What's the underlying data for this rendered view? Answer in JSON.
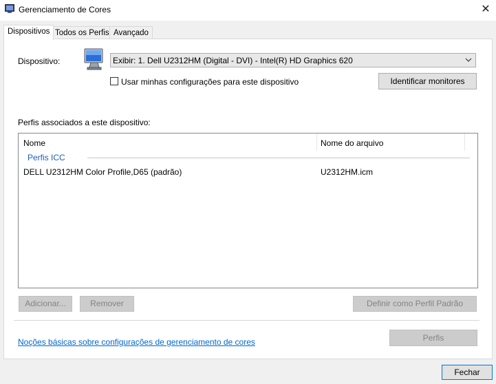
{
  "window": {
    "title": "Gerenciamento de Cores",
    "close_glyph": "✕"
  },
  "tabs": [
    {
      "label": "Dispositivos",
      "active": true
    },
    {
      "label": "Todos os Perfis",
      "active": false
    },
    {
      "label": "Avançado",
      "active": false
    }
  ],
  "device": {
    "label": "Dispositivo:",
    "selected": "Exibir: 1. Dell U2312HM (Digital - DVI) - Intel(R) HD Graphics 620",
    "use_my_settings_label": "Usar minhas configurações para este dispositivo",
    "use_my_settings_checked": false,
    "identify_button": "Identificar monitores"
  },
  "profiles": {
    "section_label": "Perfis associados a este dispositivo:",
    "columns": [
      "Nome",
      "Nome do arquivo"
    ],
    "group": "Perfis ICC",
    "rows": [
      {
        "name": "DELL U2312HM Color Profile,D65 (padrão)",
        "file": "U2312HM.icm"
      }
    ]
  },
  "buttons": {
    "add": "Adicionar...",
    "remove": "Remover",
    "set_default": "Definir como Perfil Padrão",
    "profiles": "Perfis",
    "close": "Fechar"
  },
  "help_link": "Noções básicas sobre configurações de gerenciamento de cores",
  "colors": {
    "link": "#0066cc",
    "group": "#1a5fb4",
    "focus_border": "#0078d7"
  },
  "icons": {
    "app": "color-management-icon",
    "device": "monitor-icon",
    "dropdown": "chevron-down-icon"
  }
}
